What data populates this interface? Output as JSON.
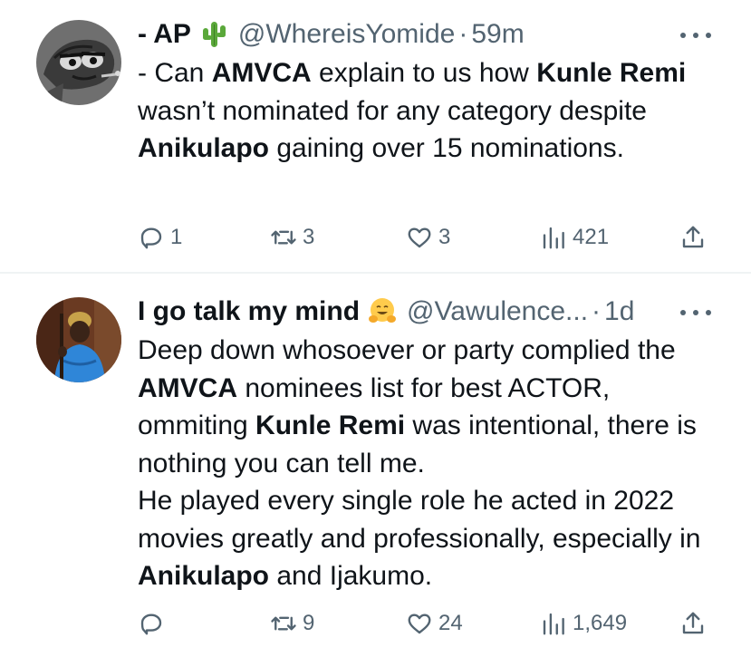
{
  "colors": {
    "text": "#0f1419",
    "muted": "#536471",
    "divider": "#eff3f4"
  },
  "tweets": [
    {
      "display_name": "- AP",
      "name_emoji": "cactus",
      "handle": "@WhereisYomide",
      "separator": "·",
      "time": "59m",
      "avatar_icon": "cartoon-fish-avatar",
      "text_segments": [
        {
          "text": "- Can ",
          "bold": false
        },
        {
          "text": "AMVCA",
          "bold": true
        },
        {
          "text": " explain to us how ",
          "bold": false
        },
        {
          "text": "Kunle Remi",
          "bold": true
        },
        {
          "text": " wasn’t nominated for any category despite ",
          "bold": false
        },
        {
          "text": "Anikulapo",
          "bold": true
        },
        {
          "text": " gaining over 15 nominations.",
          "bold": false
        }
      ],
      "actions": {
        "replies": "1",
        "retweets": "3",
        "likes": "3",
        "views": "421"
      }
    },
    {
      "display_name": "I go talk my mind",
      "name_emoji": "hugging-face",
      "handle": "@Vawulence...",
      "separator": "·",
      "time": "1d",
      "avatar_icon": "person-photo-avatar",
      "paragraphs": [
        [
          {
            "text": "Deep down whosoever or party complied the ",
            "bold": false
          },
          {
            "text": "AMVCA",
            "bold": true
          },
          {
            "text": " nominees list for best ACTOR, ommiting ",
            "bold": false
          },
          {
            "text": "Kunle Remi",
            "bold": true
          },
          {
            "text": " was intentional, there is nothing you can tell me.",
            "bold": false
          }
        ],
        [
          {
            "text": "He played every single role he acted in 2022 movies greatly and professionally, especially in ",
            "bold": false
          },
          {
            "text": "Anikulapo",
            "bold": true
          },
          {
            "text": " and Ijakumo.",
            "bold": false
          }
        ]
      ],
      "actions": {
        "replies": "",
        "retweets": "9",
        "likes": "24",
        "views": "1,649"
      }
    }
  ]
}
